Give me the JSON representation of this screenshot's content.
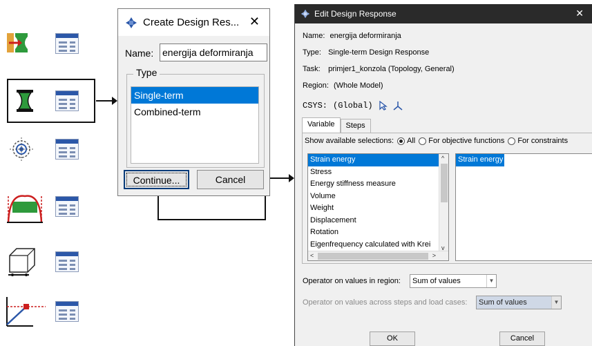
{
  "toolbox": {
    "rows": [
      {
        "icon": "create-design-response-icon",
        "manager": "design-response-manager-icon"
      },
      {
        "icon": "create-design-response-icon",
        "manager": "design-response-manager-icon"
      },
      {
        "icon": "create-objective-function-icon",
        "manager": "objective-function-manager-icon"
      },
      {
        "icon": "create-constraint-icon",
        "manager": "constraint-manager-icon"
      },
      {
        "icon": "create-geometric-restriction-icon",
        "manager": "geometric-restriction-manager-icon"
      },
      {
        "icon": "create-stop-condition-icon",
        "manager": "stop-condition-manager-icon"
      }
    ]
  },
  "create_dialog": {
    "title": "Create Design Res...",
    "close": "✕",
    "name_label": "Name:",
    "name_value": "energija deformiranja",
    "type_label": "Type",
    "types": [
      {
        "label": "Single-term",
        "selected": true
      },
      {
        "label": "Combined-term",
        "selected": false
      }
    ],
    "continue_label": "Continue...",
    "cancel_label": "Cancel"
  },
  "edit_dialog": {
    "title": "Edit Design Response",
    "close": "✕",
    "name_key": "Name:",
    "name_value": "energija deformiranja",
    "type_key": "Type:",
    "type_value": "Single-term Design Response",
    "task_key": "Task:",
    "task_value": "primjer1_konzola (Topology, General)",
    "region_key": "Region:",
    "region_value": "(Whole Model)",
    "csys_key": "CSYS:",
    "csys_value": "(Global)",
    "tabs": [
      "Variable",
      "Steps"
    ],
    "show_label": "Show available selections:",
    "show_options": [
      "All",
      "For objective functions",
      "For constraints"
    ],
    "variables": [
      "Strain energy",
      "Stress",
      "Energy stiffness measure",
      "Volume",
      "Weight",
      "Displacement",
      "Rotation",
      "Eigenfrequency calculated with Krei"
    ],
    "selected_variable": "Strain energy",
    "operator_region_label": "Operator on values in region:",
    "operator_region_value": "Sum of values",
    "operator_steps_label": "Operator on values across steps and load cases:",
    "operator_steps_value": "Sum of values",
    "ok_label": "OK",
    "cancel_label": "Cancel"
  },
  "colors": {
    "selection": "#0078d7",
    "title_dark": "#2a2a2a",
    "icon_green": "#2e9a3c",
    "icon_red": "#cc1f1f",
    "icon_blue": "#2b57a8"
  }
}
